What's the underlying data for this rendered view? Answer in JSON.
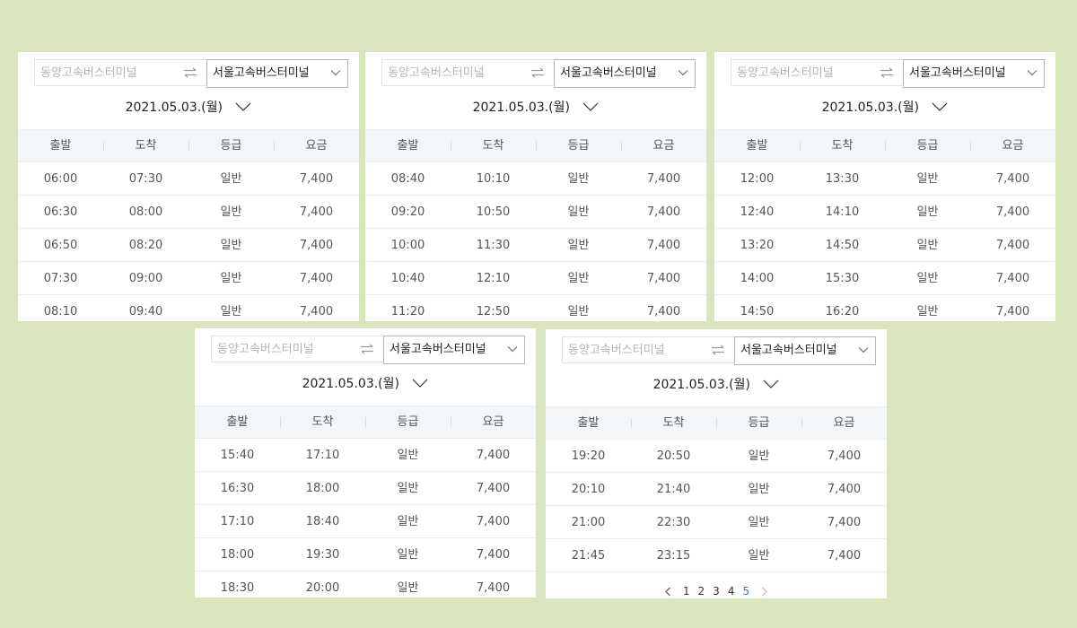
{
  "route": {
    "from_placeholder": "동양고속버스터미널",
    "to_value": "서울고속버스터미널"
  },
  "date_label": "2021.05.03.(월)",
  "columns": [
    "출발",
    "도착",
    "등급",
    "요금"
  ],
  "panels": [
    {
      "rows": [
        [
          "06:00",
          "07:30",
          "일반",
          "7,400"
        ],
        [
          "06:30",
          "08:00",
          "일반",
          "7,400"
        ],
        [
          "06:50",
          "08:20",
          "일반",
          "7,400"
        ],
        [
          "07:30",
          "09:00",
          "일반",
          "7,400"
        ],
        [
          "08:10",
          "09:40",
          "일반",
          "7,400"
        ]
      ]
    },
    {
      "rows": [
        [
          "08:40",
          "10:10",
          "일반",
          "7,400"
        ],
        [
          "09:20",
          "10:50",
          "일반",
          "7,400"
        ],
        [
          "10:00",
          "11:30",
          "일반",
          "7,400"
        ],
        [
          "10:40",
          "12:10",
          "일반",
          "7,400"
        ],
        [
          "11:20",
          "12:50",
          "일반",
          "7,400"
        ]
      ]
    },
    {
      "rows": [
        [
          "12:00",
          "13:30",
          "일반",
          "7,400"
        ],
        [
          "12:40",
          "14:10",
          "일반",
          "7,400"
        ],
        [
          "13:20",
          "14:50",
          "일반",
          "7,400"
        ],
        [
          "14:00",
          "15:30",
          "일반",
          "7,400"
        ],
        [
          "14:50",
          "16:20",
          "일반",
          "7,400"
        ]
      ]
    },
    {
      "rows": [
        [
          "15:40",
          "17:10",
          "일반",
          "7,400"
        ],
        [
          "16:30",
          "18:00",
          "일반",
          "7,400"
        ],
        [
          "17:10",
          "18:40",
          "일반",
          "7,400"
        ],
        [
          "18:00",
          "19:30",
          "일반",
          "7,400"
        ],
        [
          "18:30",
          "20:00",
          "일반",
          "7,400"
        ]
      ]
    },
    {
      "rows": [
        [
          "19:20",
          "20:50",
          "일반",
          "7,400"
        ],
        [
          "20:10",
          "21:40",
          "일반",
          "7,400"
        ],
        [
          "21:00",
          "22:30",
          "일반",
          "7,400"
        ],
        [
          "21:45",
          "23:15",
          "일반",
          "7,400"
        ]
      ],
      "pagination": {
        "pages": [
          "1",
          "2",
          "3",
          "4",
          "5"
        ],
        "current": "5"
      }
    }
  ],
  "colors": {
    "background": "#d8e5bd",
    "header_bg": "#f2f6f9",
    "active_page": "#2a7fd4"
  },
  "icons": {
    "swap": "swap-arrows-icon",
    "dropdown": "chevron-down-icon",
    "prev": "chevron-left-icon",
    "next": "chevron-right-icon"
  }
}
